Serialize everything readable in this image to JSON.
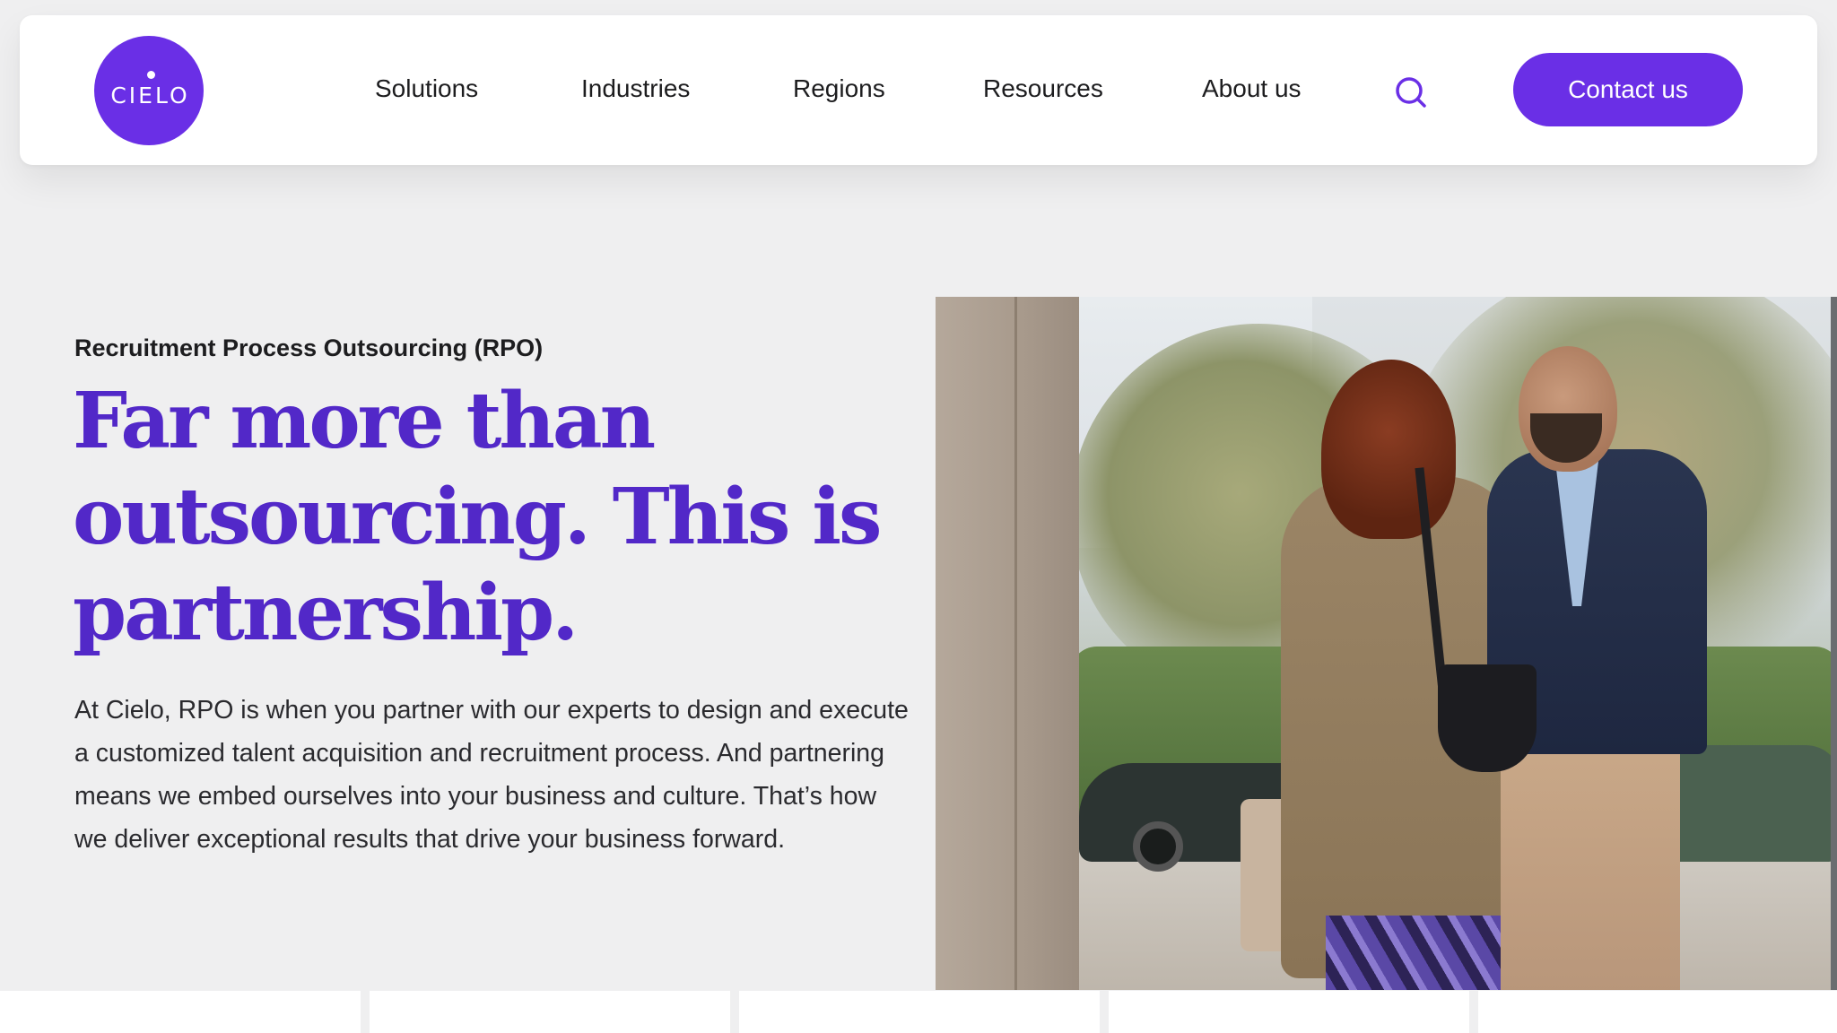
{
  "brand": {
    "name": "CIELO",
    "color": "#6a2fe6",
    "headline_color": "#5228c8"
  },
  "nav": {
    "items": [
      {
        "label": "Solutions"
      },
      {
        "label": "Industries"
      },
      {
        "label": "Regions"
      },
      {
        "label": "Resources"
      },
      {
        "label": "About us"
      }
    ],
    "search_icon": "search-icon",
    "contact_label": "Contact us"
  },
  "hero": {
    "eyebrow": "Recruitment Process Outsourcing (RPO)",
    "headline": "Far more than outsourcing. This is partnership.",
    "body": "At Cielo, RPO is when you partner with our experts to design and execute a customized talent acquisition and recruitment process. And partnering means we embed ourselves into your business and culture. That’s how we deliver exceptional results that drive your business forward.",
    "image_description_icon": "photo-two-people-talking"
  }
}
